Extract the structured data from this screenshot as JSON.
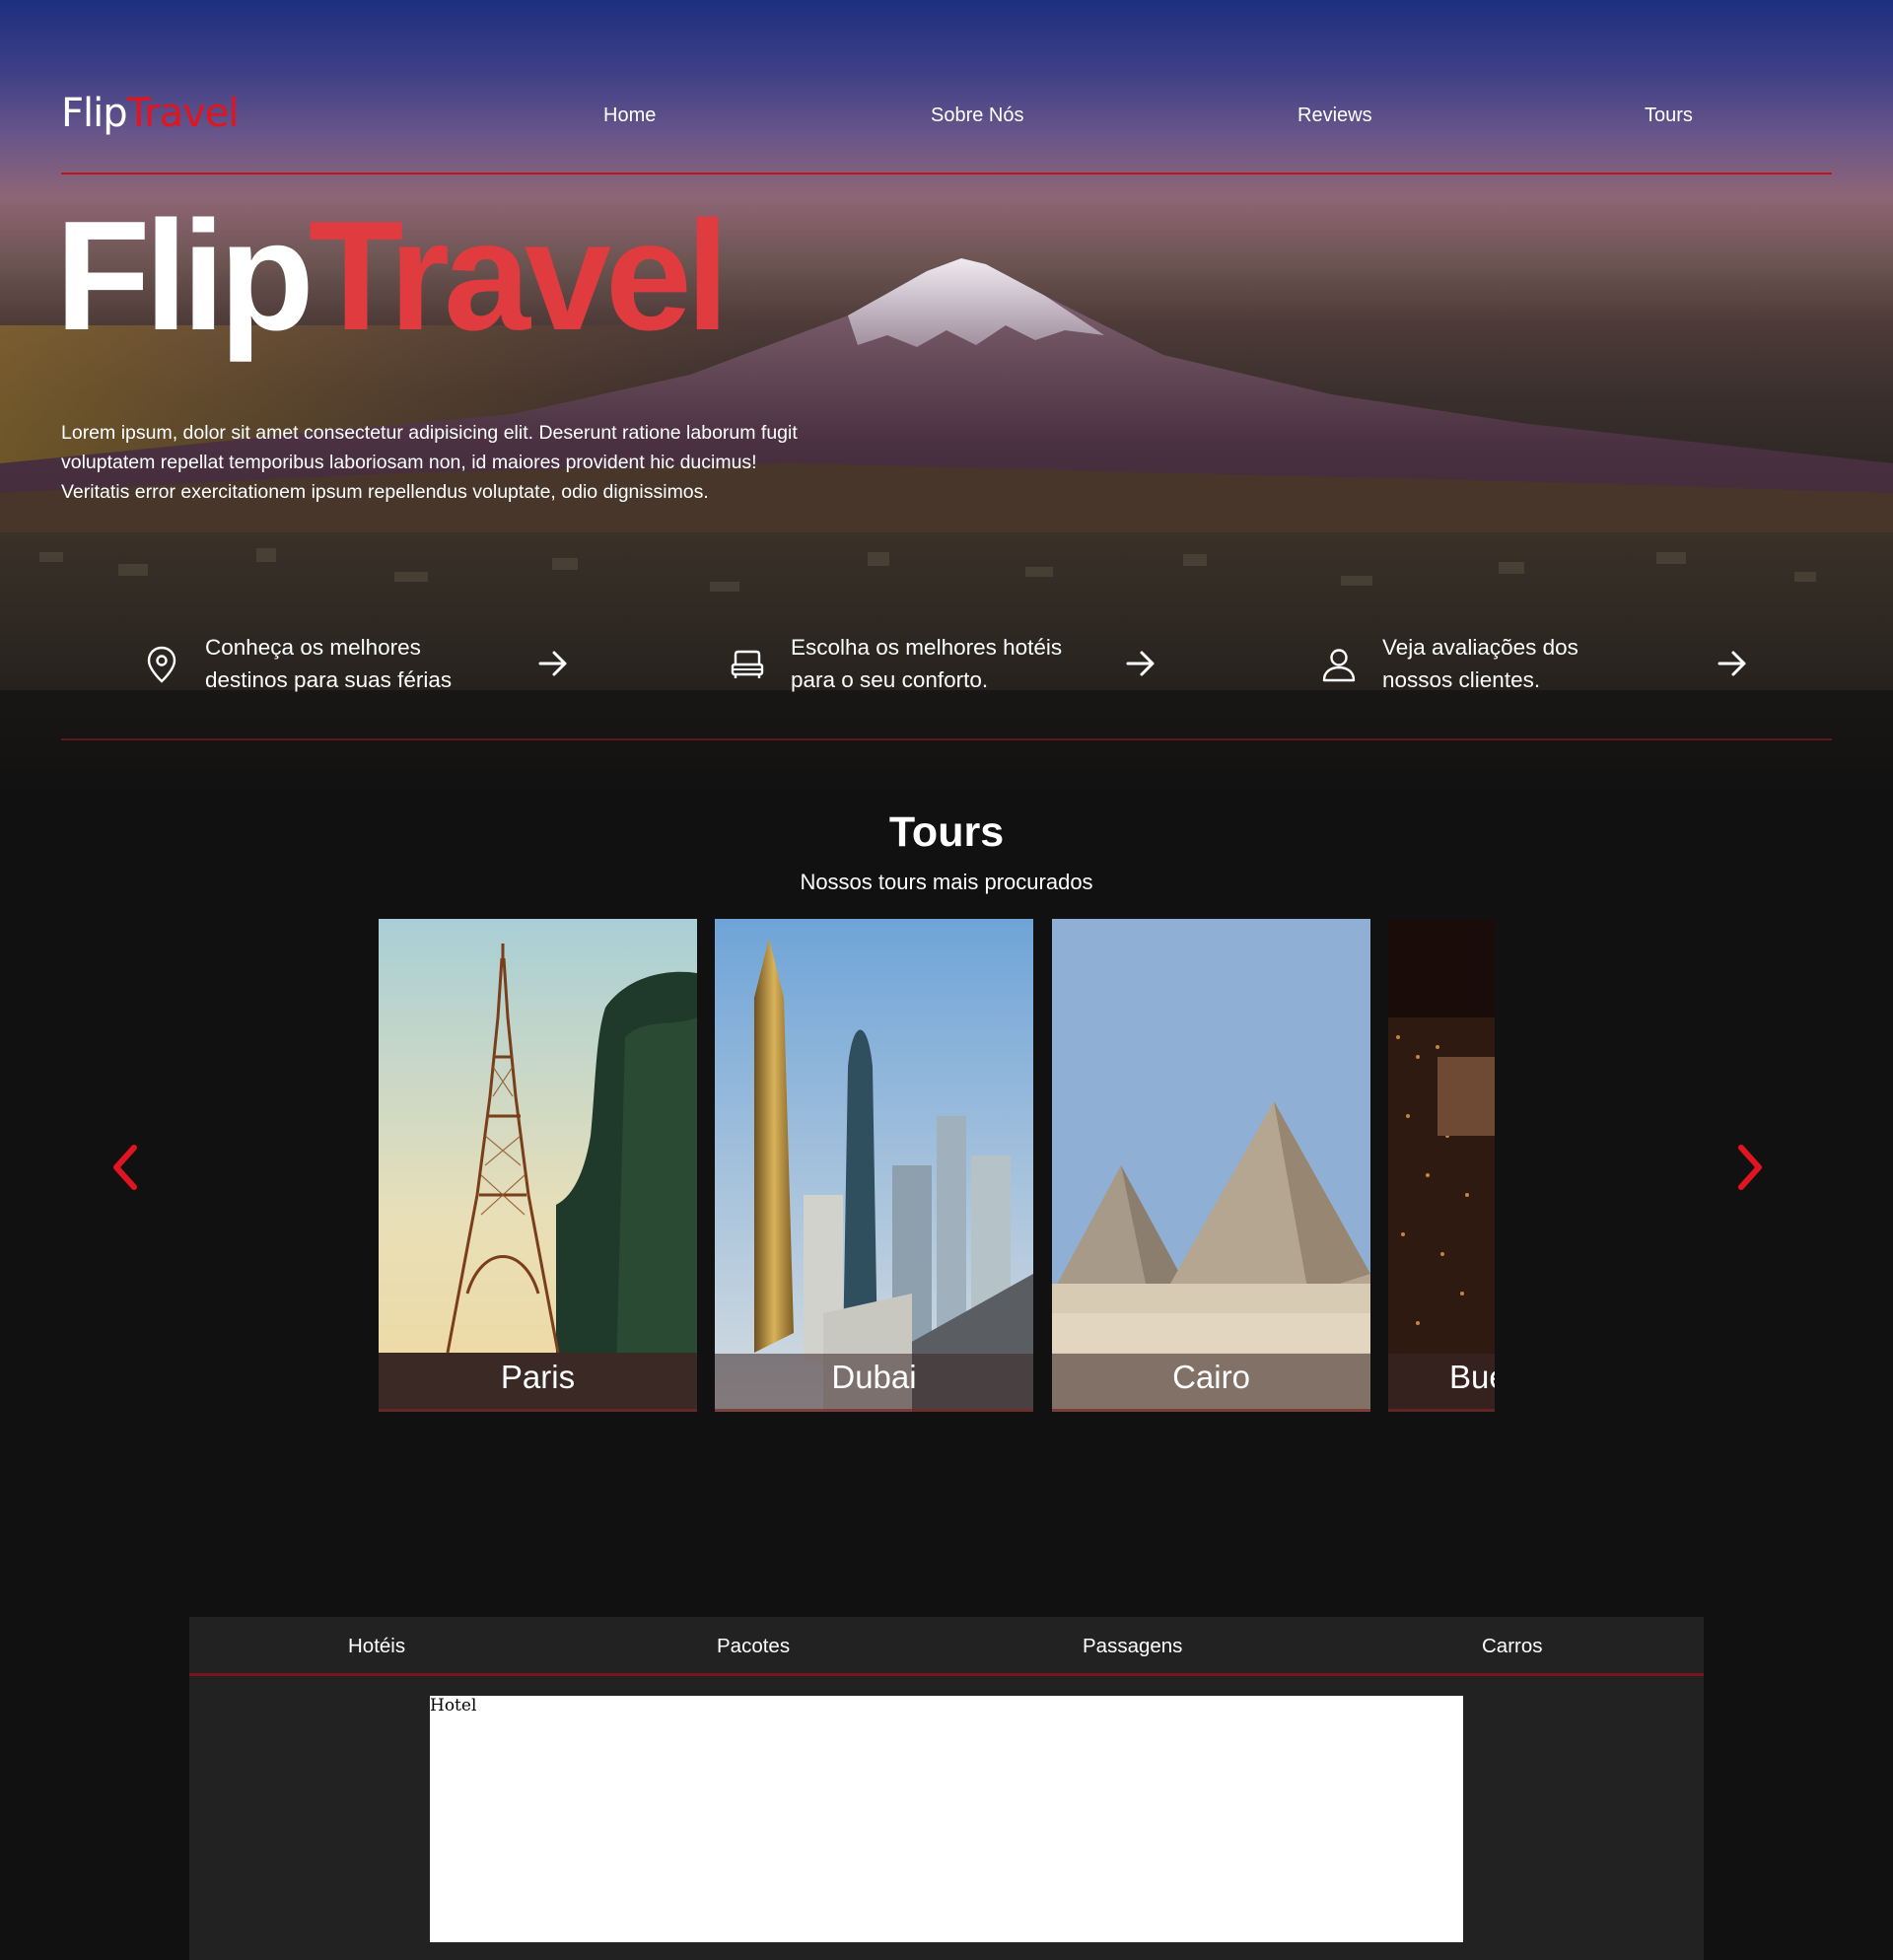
{
  "logo": {
    "part1": "Flip",
    "part2": "Travel"
  },
  "nav": {
    "items": [
      "Home",
      "Sobre Nós",
      "Reviews",
      "Tours"
    ]
  },
  "hero": {
    "title_part1": "Flip",
    "title_part2": "Travel",
    "paragraph_lines": [
      "Lorem ipsum, dolor sit amet consectetur adipisicing elit. Deserunt ratione laborum fugit",
      "voluptatem repellat temporibus laboriosam non, id maiores provident hic ducimus!",
      "Veritatis error exercitationem ipsum repellendus voluptate, odio dignissimos."
    ]
  },
  "features": [
    {
      "icon": "map-pin-icon",
      "line1": "Conheça os melhores",
      "line2": "destinos para suas férias"
    },
    {
      "icon": "bed-icon",
      "line1": "Escolha os melhores hotéis",
      "line2": "para o seu conforto."
    },
    {
      "icon": "user-icon",
      "line1": "Veja avaliações dos",
      "line2": "nossos clientes."
    }
  ],
  "tours": {
    "title": "Tours",
    "subtitle": "Nossos tours mais procurados",
    "cards": [
      "Paris",
      "Dubai",
      "Cairo",
      "Bue"
    ]
  },
  "booking": {
    "tabs": [
      "Hotéis",
      "Pacotes",
      "Passagens",
      "Carros"
    ],
    "panel_text": "Hotel"
  },
  "colors": {
    "accent": "#e0151f",
    "accent_soft": "#e03b3f",
    "background": "#111111",
    "panel": "#222222"
  }
}
